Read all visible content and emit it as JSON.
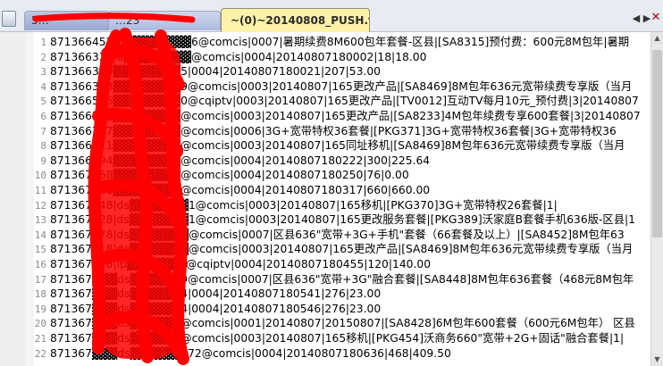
{
  "tabs": [
    {
      "label": "5…"
    },
    {
      "label": "…23"
    },
    {
      "label": "~(0)~20140808_PUSH.txt"
    }
  ],
  "nav": {
    "left": "◀",
    "right": "▶",
    "close": "✕"
  },
  "scroll": {
    "up": "▲",
    "down": "▼"
  },
  "lines": [
    {
      "n": "1",
      "t": "871366452|d▓▓▓▓▓▓▓▓6@comcis|0007|暑期续费8M600包年套餐-区县|[SA8315]预付费：600元8M包年|暑期"
    },
    {
      "n": "2",
      "t": "871366332|d▓▓▓▓▓▓▓▓@comcis|0004|20140807180002|18|18.00"
    },
    {
      "n": "3",
      "t": "871366370▓▓▓▓▓▓▓▓5|0004|20140807180021|207|53.00"
    },
    {
      "n": "4",
      "t": "871366383▓▓▓▓▓▓▓▓9@comcis|0003|20140807|165更改产品|[SA8469]8M包年636元宽带续费专享版（当月"
    },
    {
      "n": "5",
      "t": "871366566▓▓▓▓▓▓▓▓0@cqiptv|0003|20140807|165更改产品|[TV0012]互动TV每月10元_预付费|3|20140807"
    },
    {
      "n": "6",
      "t": "871366758▓▓▓▓▓▓▓▓@comcis|0003|20140807|165更改产品|[SA8233]4M包年续费专享600套餐|3|20140807"
    },
    {
      "n": "7",
      "t": "871366767▓▓▓▓▓▓▓▓@comcis|0006|3G+宽带特权36套餐|[PKG371]3G+宽带特权36套餐|3G+宽带特权36"
    },
    {
      "n": "8",
      "t": "871366811▓▓▓▓▓▓▓▓@comcis|0003|20140807|165同址移机|[SA8469]8M包年636元宽带续费专享版（当月"
    },
    {
      "n": "9",
      "t": "871366994▓▓▓▓▓▓▓▓@comcis|0004|20140807180222|300|225.64"
    },
    {
      "n": "10",
      "t": "871367068▓▓▓▓▓▓▓▓@comcis|0004|20140807180250|76|0.00"
    },
    {
      "n": "11",
      "t": "871367191▓▓▓▓▓▓▓▓@comcis|0004|20140807180317|660|660.00"
    },
    {
      "n": "12",
      "t": "871367148|ds▓▓▓▓▓▓▓1@comcis|0003|20140807|165移机|[PKG370]3G+宽带特权26套餐|1|"
    },
    {
      "n": "13",
      "t": "871367228|ds▓▓▓▓▓▓▓1@comcis|0003|20140807|165更改服务套餐|[PKG389]沃家庭B套餐手机636版-区县|1"
    },
    {
      "n": "14",
      "t": "871367478|ds▓▓▓▓▓▓▓@comcis|0007|区县636\"宽带+3G+手机\"套餐（66套餐及以上）|[SA8452]8M包年63"
    },
    {
      "n": "15",
      "t": "871367518|ds▓▓▓▓▓▓▓@comcis|0003|20140807|165更改产品|[SA8469]8M包年636元宽带续费专享版（当月"
    },
    {
      "n": "16",
      "t": "871367678|ip▓▓▓▓▓▓▓@cqiptv|0004|20140807180455|120|140.00"
    },
    {
      "n": "17",
      "t": "871367▓▓▓ds▓▓▓▓▓▓9@comcis|0007|区县636\"宽带+3G\"融合套餐|[SA8448]8M包年636套餐（468元8M包年"
    },
    {
      "n": "18",
      "t": "871367▓▓▓ds▓▓▓▓▓▓4|0004|20140807180541|276|23.00"
    },
    {
      "n": "19",
      "t": "871367▓▓▓ds▓▓▓▓▓▓4|0004|20140807180546|276|23.00"
    },
    {
      "n": "20",
      "t": "871367▓▓▓ds▓▓▓▓▓▓@comcis|0001|20140807|20150807|[SA8428]6M包年600套餐（600元6M包年） 区县"
    },
    {
      "n": "21",
      "t": "871367▓▓▓ds▓▓▓▓▓▓@comcis|0003|20140807|165移机|[PKG454]沃商务660\"宽带+2G+固话\"融合套餐|1|"
    },
    {
      "n": "22",
      "t": "871367▓▓▓ds▓▓▓▓▓▓072@comcis|0004|20140807180636|468|409.50"
    }
  ]
}
